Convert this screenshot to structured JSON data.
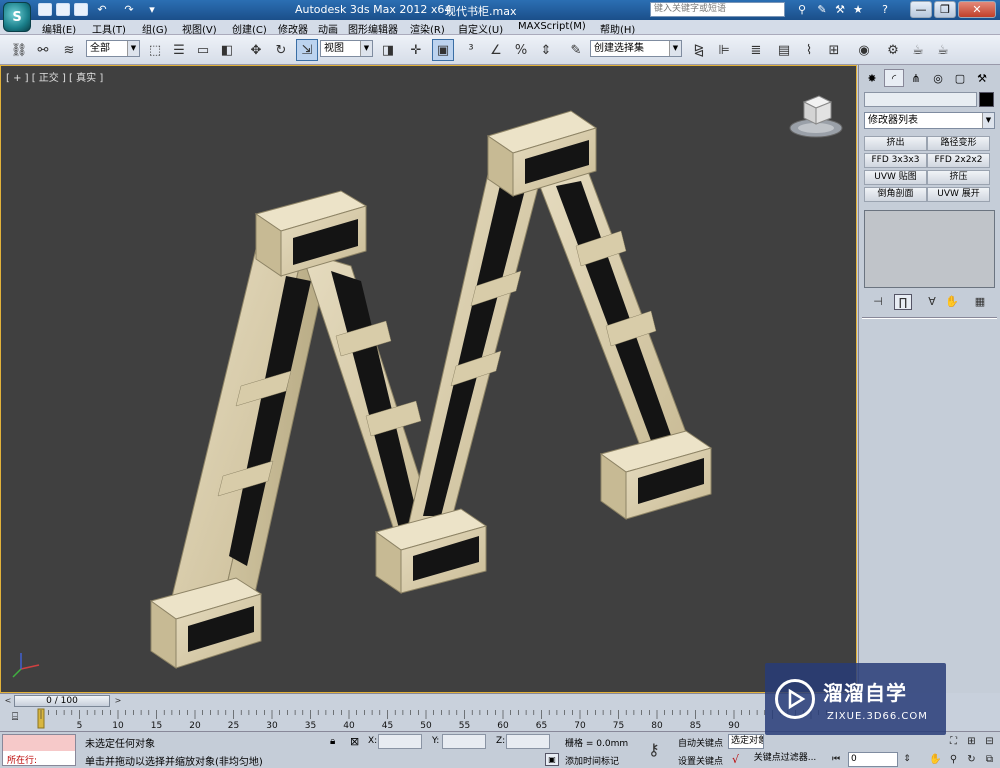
{
  "title_bar": {
    "app_title": "Autodesk 3ds Max  2012 x64",
    "file_name": "现代书柜.max",
    "search_placeholder": "键入关键字或短语",
    "logo_letter": "S",
    "minimize": "—",
    "restore": "❐",
    "close": "✕"
  },
  "menu": {
    "items": [
      "编辑(E)",
      "工具(T)",
      "组(G)",
      "视图(V)",
      "创建(C)",
      "修改器",
      "动画",
      "图形编辑器",
      "渲染(R)",
      "自定义(U)",
      "MAXScript(M)",
      "帮助(H)"
    ]
  },
  "toolbar": {
    "selection_filter": "全部",
    "ref_coord": "视图",
    "named_selection": "创建选择集"
  },
  "viewport": {
    "label": "[ + ] [ 正交 ] [ 真实 ]"
  },
  "command_panel": {
    "modifier_list": "修改器列表",
    "modifier_buttons": [
      "挤出",
      "路径变形",
      "FFD 3x3x3",
      "FFD 2x2x2",
      "UVW 贴图",
      "挤压",
      "倒角剖面",
      "UVW 展开"
    ]
  },
  "time_slider": {
    "position": "0 / 100",
    "current_frame": 0,
    "total_frames": 100,
    "prev": "<",
    "next": ">"
  },
  "trackbar": {
    "ticks": [
      0,
      5,
      10,
      15,
      20,
      25,
      30,
      35,
      40,
      45,
      50,
      55,
      60,
      65,
      70,
      75,
      80,
      85,
      90
    ]
  },
  "status_bar": {
    "maxscript_label": "所在行:",
    "selection_status": "未选定任何对象",
    "prompt": "单击并拖动以选择并缩放对象(非均匀地)",
    "x_label": "X:",
    "y_label": "Y:",
    "z_label": "Z:",
    "grid": "栅格 = 0.0mm",
    "add_time_tag": "添加时间标记",
    "auto_key": "自动关键点",
    "set_key": "设置关键点",
    "selected_object": "选定对象",
    "key_filters": "关键点过滤器...",
    "frame_value": "0"
  },
  "watermark": {
    "title": "溜溜自学",
    "url": "ZIXUE.3D66.COM"
  }
}
